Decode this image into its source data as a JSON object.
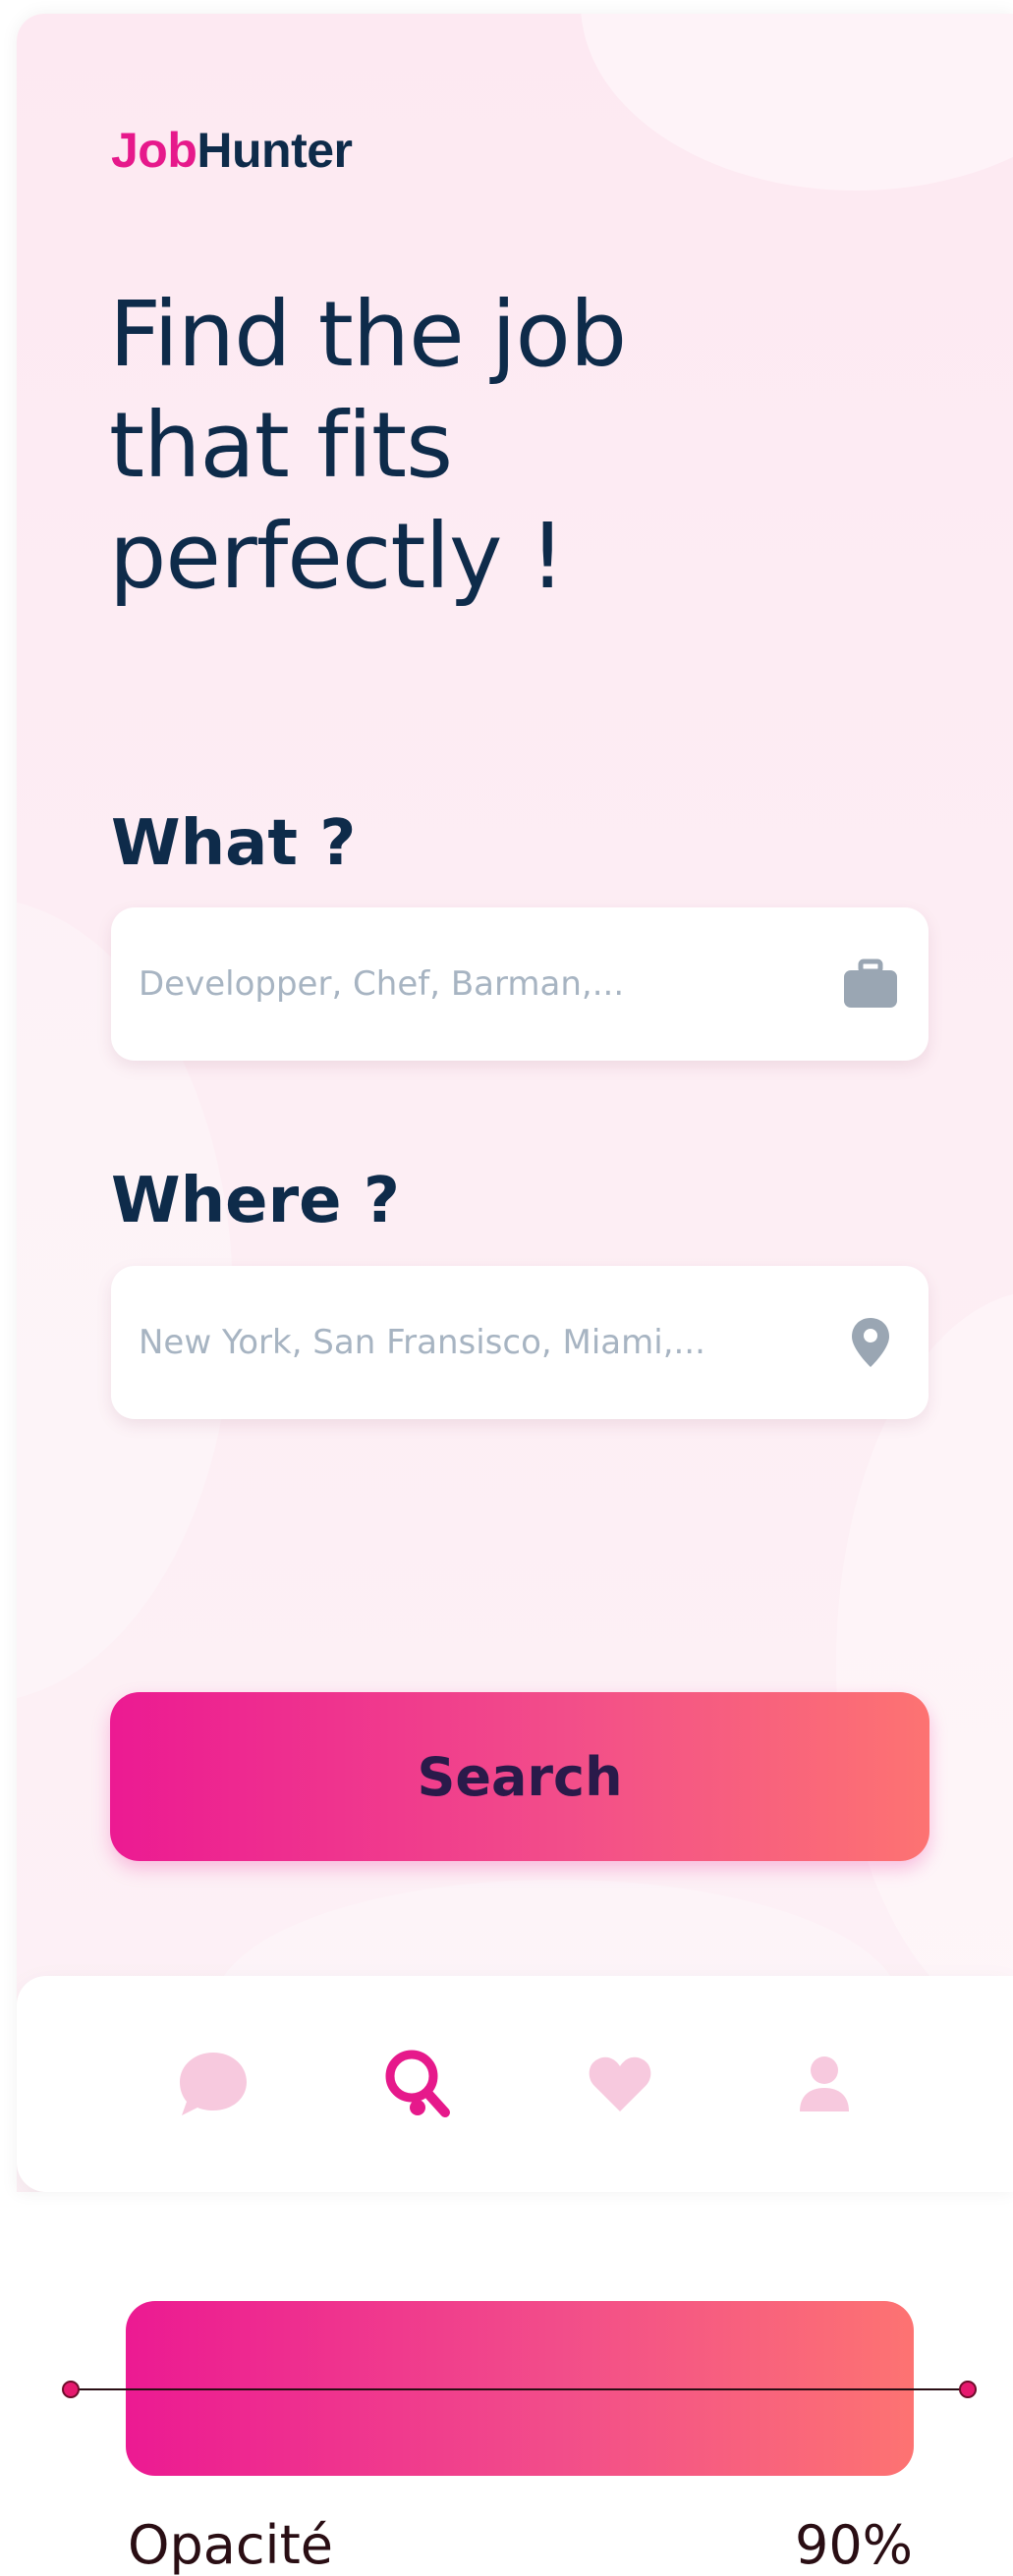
{
  "app": {
    "logo_part1": "Job",
    "logo_part2": "Hunter",
    "headline_line1": "Find the job",
    "headline_line2": "that fits",
    "headline_line3": "perfectly !"
  },
  "form": {
    "what_label": "What ?",
    "what_placeholder": "Developper, Chef, Barman,...",
    "what_icon": "briefcase-icon",
    "where_label": "Where ?",
    "where_placeholder": "New York, San Fransisco, Miami,...",
    "where_icon": "location-pin-icon",
    "search_label": "Search"
  },
  "nav": {
    "items": [
      {
        "icon": "chat-bubble-icon",
        "active": false
      },
      {
        "icon": "search-icon",
        "active": true
      },
      {
        "icon": "heart-icon",
        "active": false
      },
      {
        "icon": "user-icon",
        "active": false
      }
    ]
  },
  "opacity_control": {
    "label": "Opacité",
    "value_text": "90%",
    "value": 0.9
  },
  "colors": {
    "brand_pink": "#e6198b",
    "navy": "#0e2b4a",
    "gradient_start": "#ec1a92",
    "gradient_end": "#fd7372",
    "nav_inactive": "#f7c9de",
    "placeholder": "#a7b4c2",
    "icon_gray": "#9aa6b3"
  }
}
